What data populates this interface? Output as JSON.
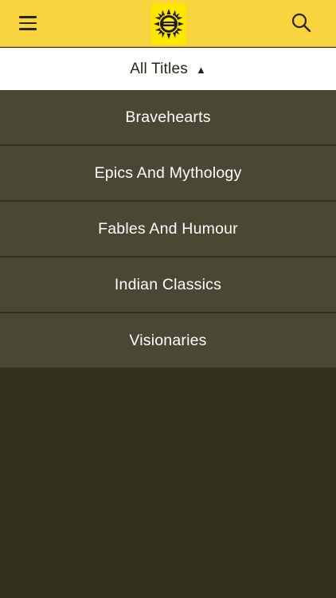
{
  "header": {
    "menu_icon": "hamburger-menu-icon",
    "logo_icon": "amar-chitra-katha-logo",
    "search_icon": "search-icon",
    "colors": {
      "background": "#f9d43e",
      "logo_bg": "#ffe600"
    }
  },
  "filter": {
    "label": "All Titles",
    "arrow": "▲"
  },
  "categories": [
    {
      "label": "Bravehearts"
    },
    {
      "label": "Epics And Mythology"
    },
    {
      "label": "Fables And Humour"
    },
    {
      "label": "Indian Classics"
    },
    {
      "label": "Visionaries"
    }
  ],
  "colors": {
    "list_item_bg": "#4a4834",
    "page_bg": "#34321e"
  }
}
